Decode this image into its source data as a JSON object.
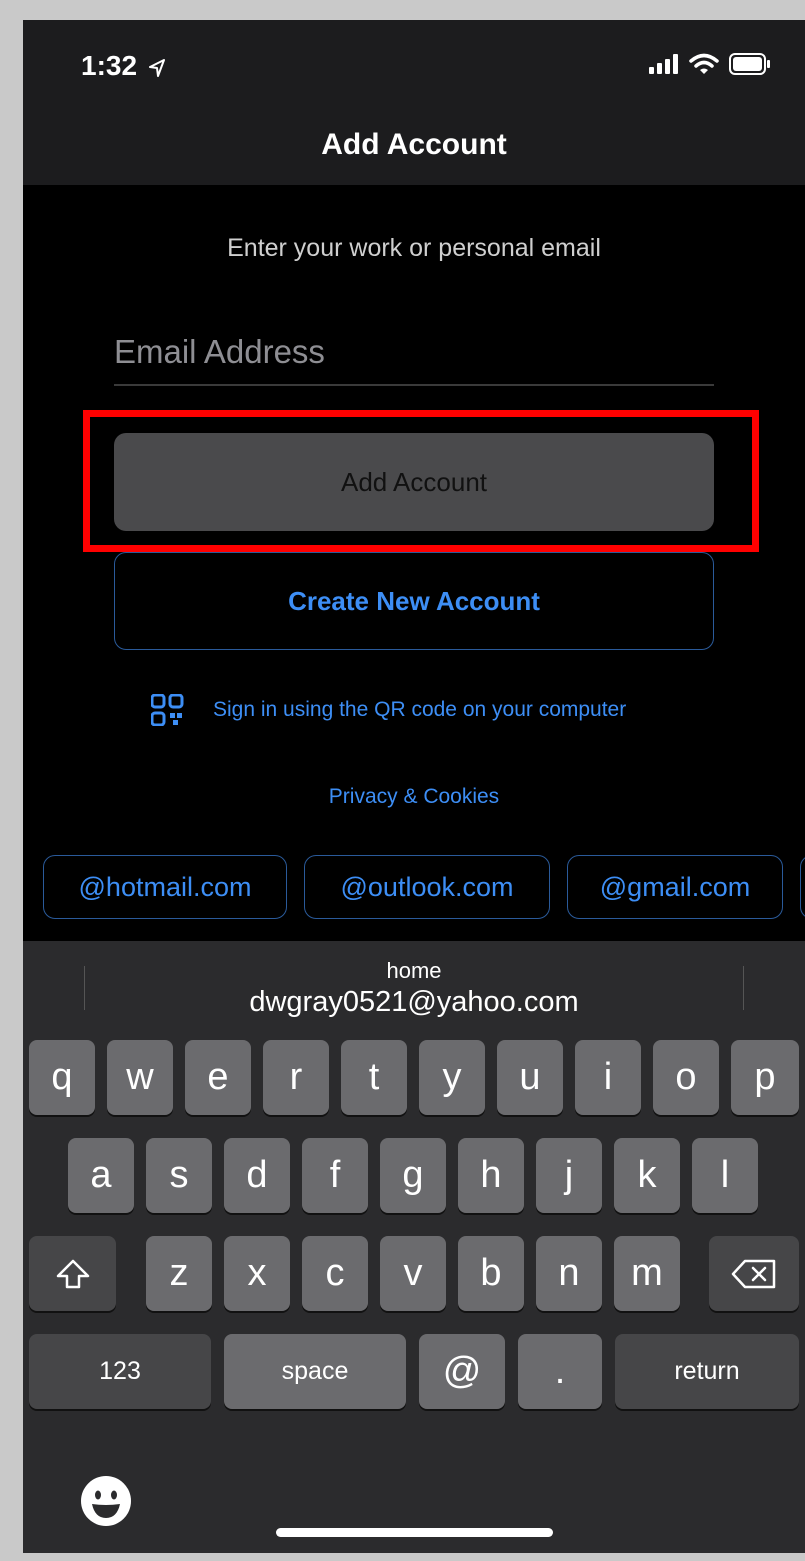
{
  "status_bar": {
    "time": "1:32",
    "icons": [
      "location-arrow-icon",
      "signal-icon",
      "wifi-icon",
      "battery-icon"
    ]
  },
  "nav": {
    "title": "Add Account"
  },
  "form": {
    "subtitle": "Enter your work or personal email",
    "email_placeholder": "Email Address",
    "email_value": "",
    "add_account_label": "Add Account",
    "create_account_label": "Create New Account",
    "qr_label": "Sign in using the QR code on your computer",
    "privacy_label": "Privacy & Cookies"
  },
  "domain_chips": [
    "@hotmail.com",
    "@outlook.com",
    "@gmail.com"
  ],
  "keyboard": {
    "suggestion_label": "home",
    "suggestion_value": "dwgray0521@yahoo.com",
    "row1": [
      "q",
      "w",
      "e",
      "r",
      "t",
      "y",
      "u",
      "i",
      "o",
      "p"
    ],
    "row2": [
      "a",
      "s",
      "d",
      "f",
      "g",
      "h",
      "j",
      "k",
      "l"
    ],
    "row3": [
      "z",
      "x",
      "c",
      "v",
      "b",
      "n",
      "m"
    ],
    "numbers_label": "123",
    "space_label": "space",
    "at_label": "@",
    "dot_label": ".",
    "return_label": "return",
    "shift_icon": "shift-icon",
    "delete_icon": "delete-icon",
    "emoji_icon": "emoji-icon"
  },
  "colors": {
    "accent": "#3d8ef5",
    "highlight": "#ff0000",
    "background": "#000000"
  }
}
